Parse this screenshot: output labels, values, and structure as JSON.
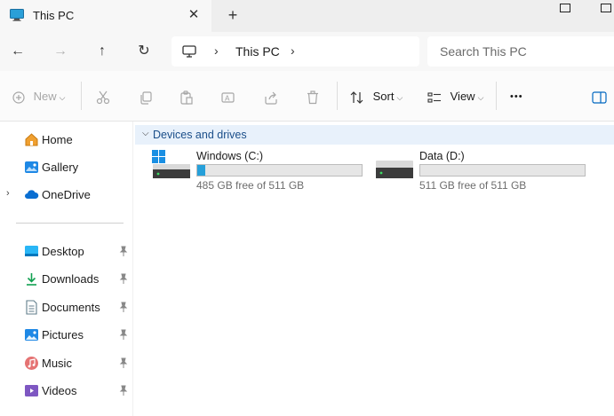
{
  "tab": {
    "title": "This PC",
    "close_glyph": "✕",
    "new_tab_glyph": "+"
  },
  "nav": {
    "back": "←",
    "forward": "→",
    "up": "↑",
    "refresh": "↻"
  },
  "address": {
    "sep": "›",
    "location": "This PC"
  },
  "search": {
    "placeholder": "Search This PC"
  },
  "toolbar": {
    "new_label": "New",
    "sort_label": "Sort",
    "view_label": "View",
    "more_label": "•••",
    "icons": [
      "plus-icon",
      "cut-icon",
      "copy-icon",
      "paste-icon",
      "rename-icon",
      "share-icon",
      "delete-icon",
      "sort-icon",
      "view-icon",
      "more-icon",
      "details-pane-icon"
    ]
  },
  "sidebar": {
    "items": [
      {
        "label": "Home",
        "icon": "home-icon"
      },
      {
        "label": "Gallery",
        "icon": "gallery-icon"
      },
      {
        "label": "OneDrive",
        "icon": "onedrive-icon",
        "expand": "›"
      },
      {
        "label": "Desktop",
        "icon": "desktop-icon",
        "pinned": true
      },
      {
        "label": "Downloads",
        "icon": "download-icon",
        "pinned": true
      },
      {
        "label": "Documents",
        "icon": "documents-icon",
        "pinned": true
      },
      {
        "label": "Pictures",
        "icon": "pictures-icon",
        "pinned": true
      },
      {
        "label": "Music",
        "icon": "music-icon",
        "pinned": true
      },
      {
        "label": "Videos",
        "icon": "videos-icon",
        "pinned": true
      }
    ]
  },
  "group": {
    "label": "Devices and drives",
    "chevron": "⌵"
  },
  "drives": [
    {
      "name": "Windows (C:)",
      "free_text": "485 GB free of 511 GB",
      "used_fraction": 0.051
    },
    {
      "name": "Data (D:)",
      "free_text": "511 GB free of 511 GB",
      "used_fraction": 0.0
    }
  ],
  "colors": {
    "accent": "#26a0da",
    "group_header_bg": "#e8f1fb",
    "group_header_text": "#1b4f8a"
  }
}
